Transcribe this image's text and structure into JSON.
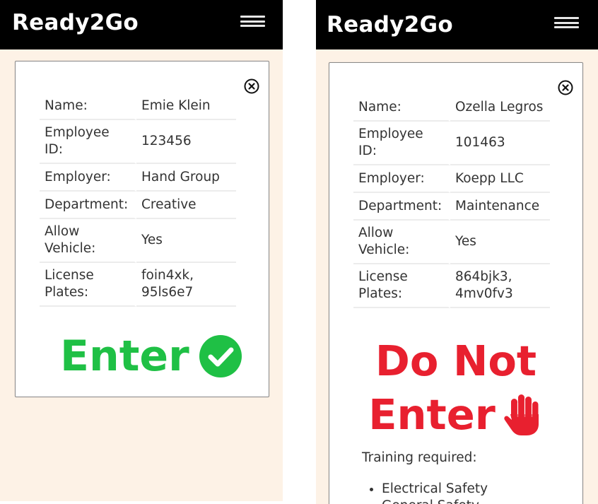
{
  "app": {
    "title": "Ready2Go"
  },
  "screens": [
    {
      "fields": [
        {
          "label": "Name:",
          "value": "Emie Klein"
        },
        {
          "label": "Employee ID:",
          "value": "123456"
        },
        {
          "label": "Employer:",
          "value": "Hand Group"
        },
        {
          "label": "Department:",
          "value": "Creative"
        },
        {
          "label": "Allow Vehicle:",
          "value": "Yes"
        },
        {
          "label": "License Plates:",
          "value": "foin4xk, 95ls6e7"
        }
      ],
      "status": {
        "text": "Enter",
        "icon": "check-circle-icon",
        "color": "#1fc045"
      }
    },
    {
      "fields": [
        {
          "label": "Name:",
          "value": "Ozella Legros"
        },
        {
          "label": "Employee ID:",
          "value": "101463"
        },
        {
          "label": "Employer:",
          "value": "Koepp LLC"
        },
        {
          "label": "Department:",
          "value": "Maintenance"
        },
        {
          "label": "Allow Vehicle:",
          "value": "Yes"
        },
        {
          "label": "License Plates:",
          "value": "864bjk3, 4mv0fv3"
        }
      ],
      "status": {
        "line1": "Do Not",
        "line2": "Enter",
        "icon": "stop-hand-icon",
        "color": "#e8202f"
      },
      "training": {
        "heading": "Training required:",
        "items": [
          "Electrical Safety",
          "General Safety"
        ]
      }
    }
  ],
  "colors": {
    "navbar": "#000000",
    "background": "#fdf2e6",
    "card": "#ffffff"
  },
  "icons": {
    "menu": "hamburger-menu-icon",
    "close": "close-circle-icon"
  }
}
